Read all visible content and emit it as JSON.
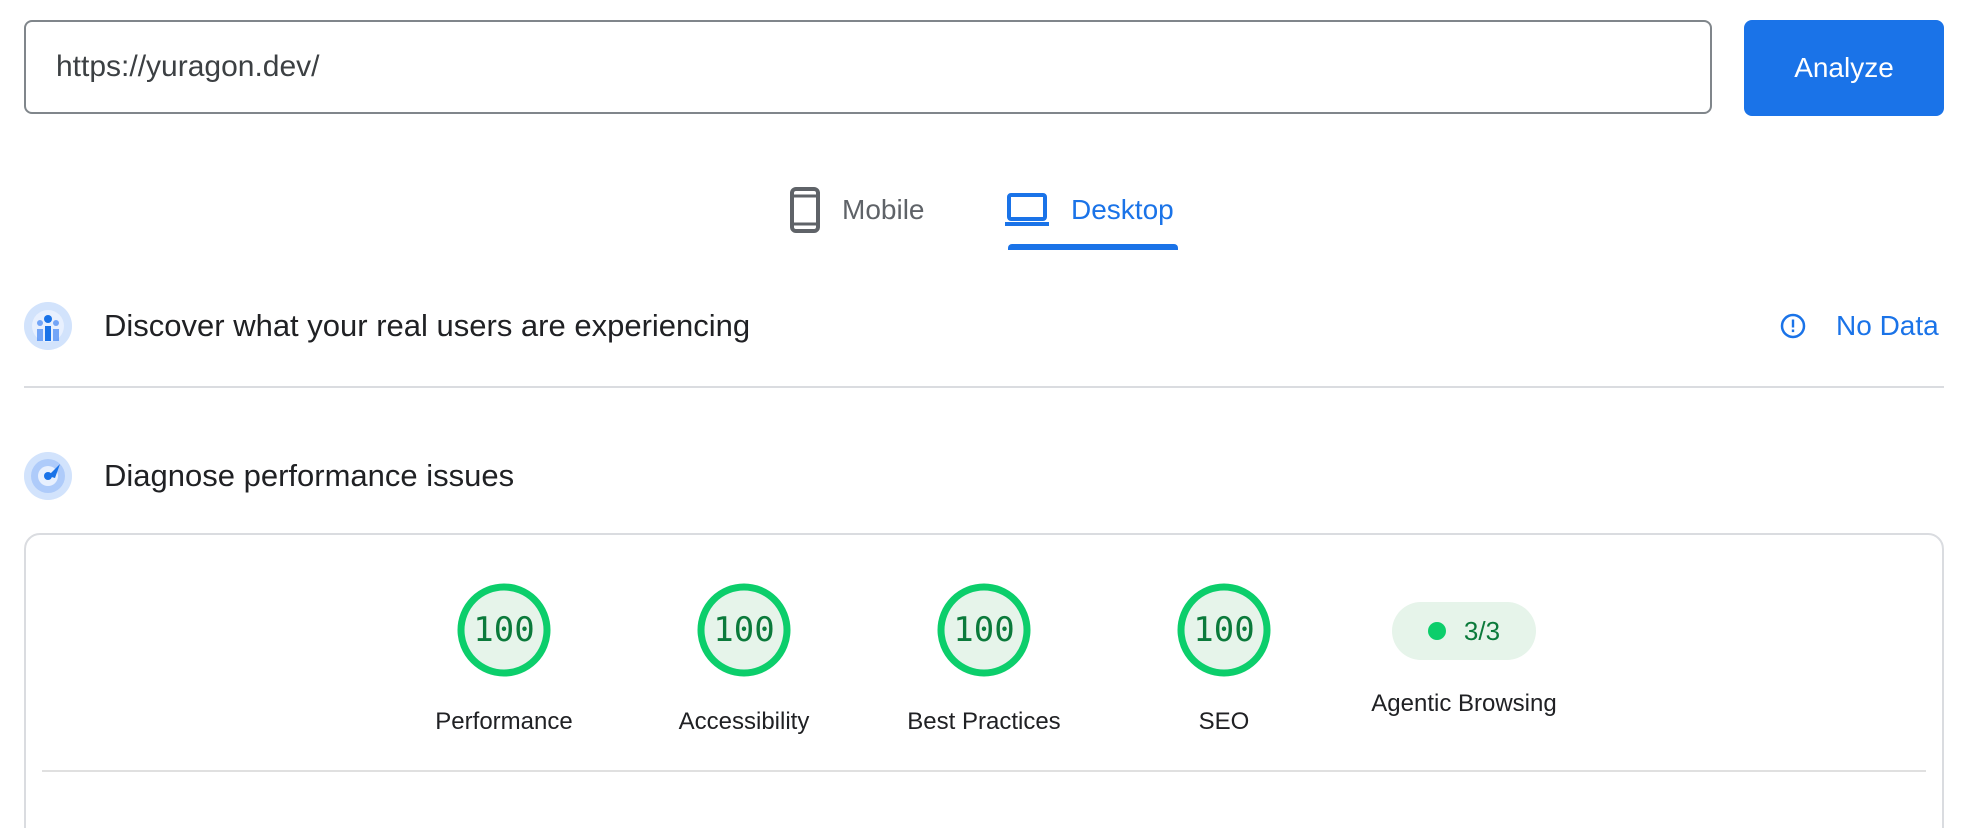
{
  "search": {
    "url_value": "https://yuragon.dev/",
    "analyze_label": "Analyze"
  },
  "tabs": [
    {
      "label": "Mobile",
      "icon": "smartphone-icon",
      "selected": false
    },
    {
      "label": "Desktop",
      "icon": "laptop-icon",
      "selected": true
    }
  ],
  "crux": {
    "icon": "users-chart-icon",
    "title": "Discover what your real users are experiencing",
    "status_icon": "info-icon",
    "status_label": "No Data"
  },
  "diagnose": {
    "icon": "radar-icon",
    "title": "Diagnose performance issues"
  },
  "scores": [
    {
      "label": "Performance",
      "value": "100"
    },
    {
      "label": "Accessibility",
      "value": "100"
    },
    {
      "label": "Best Practices",
      "value": "100"
    },
    {
      "label": "SEO",
      "value": "100"
    }
  ],
  "agentic": {
    "label": "Agentic Browsing",
    "value": "3/3"
  },
  "colors": {
    "accent": "#1a73e8",
    "pass": "#0cce6b",
    "pass_text": "#0b7a3b",
    "pass_bg": "#e6f4ea"
  }
}
